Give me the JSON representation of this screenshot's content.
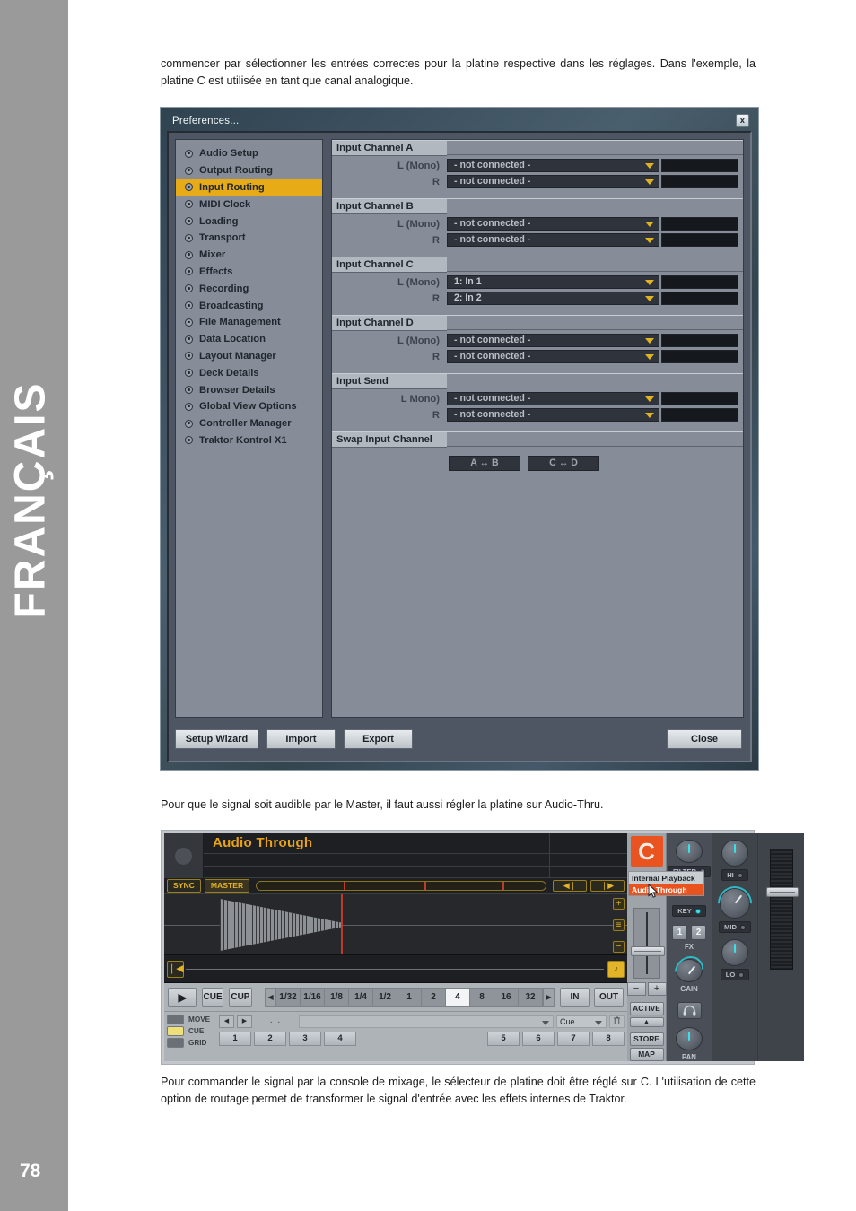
{
  "page": {
    "language_rail": "FRANÇAIS",
    "page_number": "78"
  },
  "text": {
    "intro": "commencer par sélectionner les entrées correctes pour la platine respective dans les réglages. Dans l'exemple, la platine C est utilisée en tant que canal analogique.",
    "middle": "Pour que le signal soit audible par le Master, il faut aussi régler la platine sur Audio-Thru.",
    "outro": "Pour commander le signal par la console de mixage, le sélecteur de platine doit être réglé sur C. L'utilisation de cette option de routage permet de transformer le signal d'entrée avec les effets internes de Traktor."
  },
  "preferences": {
    "title": "Preferences...",
    "close_icon": "x",
    "sidebar": [
      {
        "label": "Audio Setup",
        "active": false
      },
      {
        "label": "Output Routing",
        "active": false
      },
      {
        "label": "Input Routing",
        "active": true
      },
      {
        "label": "MIDI Clock",
        "active": false
      },
      {
        "label": "Loading",
        "active": false
      },
      {
        "label": "Transport",
        "active": false
      },
      {
        "label": "Mixer",
        "active": false
      },
      {
        "label": "Effects",
        "active": false
      },
      {
        "label": "Recording",
        "active": false
      },
      {
        "label": "Broadcasting",
        "active": false
      },
      {
        "label": "File Management",
        "active": false
      },
      {
        "label": "Data Location",
        "active": false
      },
      {
        "label": "Layout Manager",
        "active": false
      },
      {
        "label": "Deck Details",
        "active": false
      },
      {
        "label": "Browser Details",
        "active": false
      },
      {
        "label": "Global View Options",
        "active": false
      },
      {
        "label": "Controller Manager",
        "active": false
      },
      {
        "label": "Traktor Kontrol X1",
        "active": false
      }
    ],
    "groups": [
      {
        "title": "Input Channel A",
        "rows": [
          {
            "label": "L (Mono)",
            "value": "- not connected -"
          },
          {
            "label": "R",
            "value": "- not connected -"
          }
        ]
      },
      {
        "title": "Input Channel B",
        "rows": [
          {
            "label": "L (Mono)",
            "value": "- not connected -"
          },
          {
            "label": "R",
            "value": "- not connected -"
          }
        ]
      },
      {
        "title": "Input Channel C",
        "rows": [
          {
            "label": "L (Mono)",
            "value": "1: In 1"
          },
          {
            "label": "R",
            "value": "2: In 2"
          }
        ]
      },
      {
        "title": "Input Channel D",
        "rows": [
          {
            "label": "L (Mono)",
            "value": "- not connected -"
          },
          {
            "label": "R",
            "value": "- not connected -"
          }
        ]
      },
      {
        "title": "Input Send",
        "rows": [
          {
            "label": "L Mono)",
            "value": "- not connected -"
          },
          {
            "label": "R",
            "value": "- not connected -"
          }
        ]
      }
    ],
    "swap": {
      "title": "Swap Input Channel",
      "buttons": [
        "A ↔ B",
        "C ↔ D"
      ]
    },
    "footer": {
      "setup_wizard": "Setup Wizard",
      "import": "Import",
      "export": "Export",
      "close": "Close"
    },
    "accent_color": "#e6ab17"
  },
  "deck": {
    "track_title": "Audio Through",
    "deck_letter": "C",
    "sync_label": "SYNC",
    "master_label": "MASTER",
    "nudge_back": "◀❘",
    "nudge_fwd": "❘▶",
    "waveform_buttons": [
      "+",
      "≡",
      "−"
    ],
    "overview_start_icon": "❘◀",
    "overview_end_icon": "♪",
    "transport": {
      "play": "▶",
      "cue": "CUE",
      "cup": "CUP",
      "beat_prev": "◀",
      "beat_next": "▶",
      "beat_values": [
        "1/32",
        "1/16",
        "1/8",
        "1/4",
        "1/2",
        "1",
        "2",
        "4",
        "8",
        "16",
        "32"
      ],
      "beat_active": "4",
      "in": "IN",
      "out": "OUT"
    },
    "hotcue": {
      "toggles": [
        {
          "label": "MOVE",
          "on": false
        },
        {
          "label": "CUE",
          "on": true
        },
        {
          "label": "GRID",
          "on": false
        }
      ],
      "nav_prev": "◀",
      "nav_next": "▶",
      "dots": "···",
      "type_value": "Cue",
      "trash_icon": "Ὕ1",
      "pads_left": [
        "1",
        "2",
        "3",
        "4"
      ],
      "pads_right": [
        "5",
        "6",
        "7",
        "8"
      ]
    },
    "tempo": {
      "minus": "−",
      "plus": "+",
      "active": "ACTIVE",
      "collapse_icon": "▲",
      "store": "STORE",
      "map": "MAP"
    },
    "fx_column": {
      "filter_label": "FILTER",
      "key_label": "KEY",
      "fx_pads": [
        "1",
        "2"
      ],
      "fx_label": "FX",
      "gain_label": "GAIN",
      "headphone_icon": "headphone-icon",
      "pan_label": "PAN"
    },
    "eq_column": {
      "hi_label": "HI",
      "mid_label": "MID",
      "lo_label": "LO"
    },
    "popup": {
      "items": [
        {
          "label": "Internal Playback",
          "selected": false
        },
        {
          "label": "Audio Through",
          "selected": true
        }
      ]
    },
    "colors": {
      "deck_letter_bg": "#e8531f",
      "title_text": "#e8a317",
      "playhead": "#c0392b",
      "knob_pointer": "#39e0e8"
    }
  }
}
